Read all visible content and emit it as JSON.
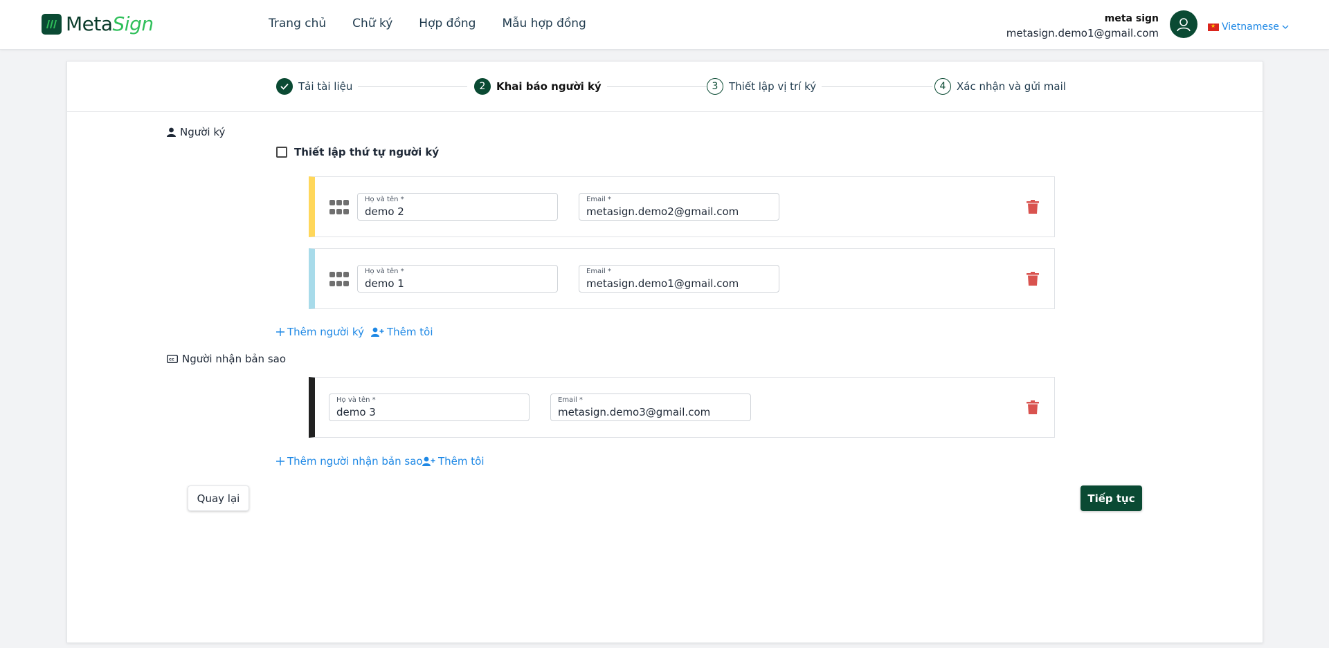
{
  "header": {
    "logo_meta": "Meta",
    "logo_sign": "Sign",
    "nav": [
      "Trang chủ",
      "Chữ ký",
      "Hợp đồng",
      "Mẫu hợp đồng"
    ],
    "user_name": "meta sign",
    "user_email": "metasign.demo1@gmail.com",
    "language": "Vietnamese"
  },
  "steps": [
    {
      "num": "✓",
      "label": "Tải tài liệu",
      "state": "done"
    },
    {
      "num": "2",
      "label": "Khai báo người ký",
      "state": "active"
    },
    {
      "num": "3",
      "label": "Thiết lập vị trí ký",
      "state": "todo"
    },
    {
      "num": "4",
      "label": "Xác nhận và gửi mail",
      "state": "todo"
    }
  ],
  "signers": {
    "title": "Người ký",
    "order_checkbox_label": "Thiết lập thứ tự người ký",
    "order_checked": false,
    "rows": [
      {
        "name_label": "Họ và tên *",
        "name": "demo 2",
        "email_label": "Email *",
        "email": "metasign.demo2@gmail.com",
        "color": "#ffd75a"
      },
      {
        "name_label": "Họ và tên *",
        "name": "demo 1",
        "email_label": "Email *",
        "email": "metasign.demo1@gmail.com",
        "color": "#a8dbea"
      }
    ],
    "add_label": "Thêm người ký",
    "add_me_label": "Thêm tôi"
  },
  "cc": {
    "title": "Người nhận bản sao",
    "rows": [
      {
        "name_label": "Họ và tên *",
        "name": "demo 3",
        "email_label": "Email *",
        "email": "metasign.demo3@gmail.com",
        "color": "#212121"
      }
    ],
    "add_label": "Thêm người nhận bản sao",
    "add_me_label": "Thêm tôi"
  },
  "buttons": {
    "back": "Quay lại",
    "next": "Tiếp tục"
  },
  "colors": {
    "brand": "#0a4a33",
    "accent_green": "#2fbf5a",
    "link": "#1e88e5",
    "delete": "#d9534f"
  }
}
